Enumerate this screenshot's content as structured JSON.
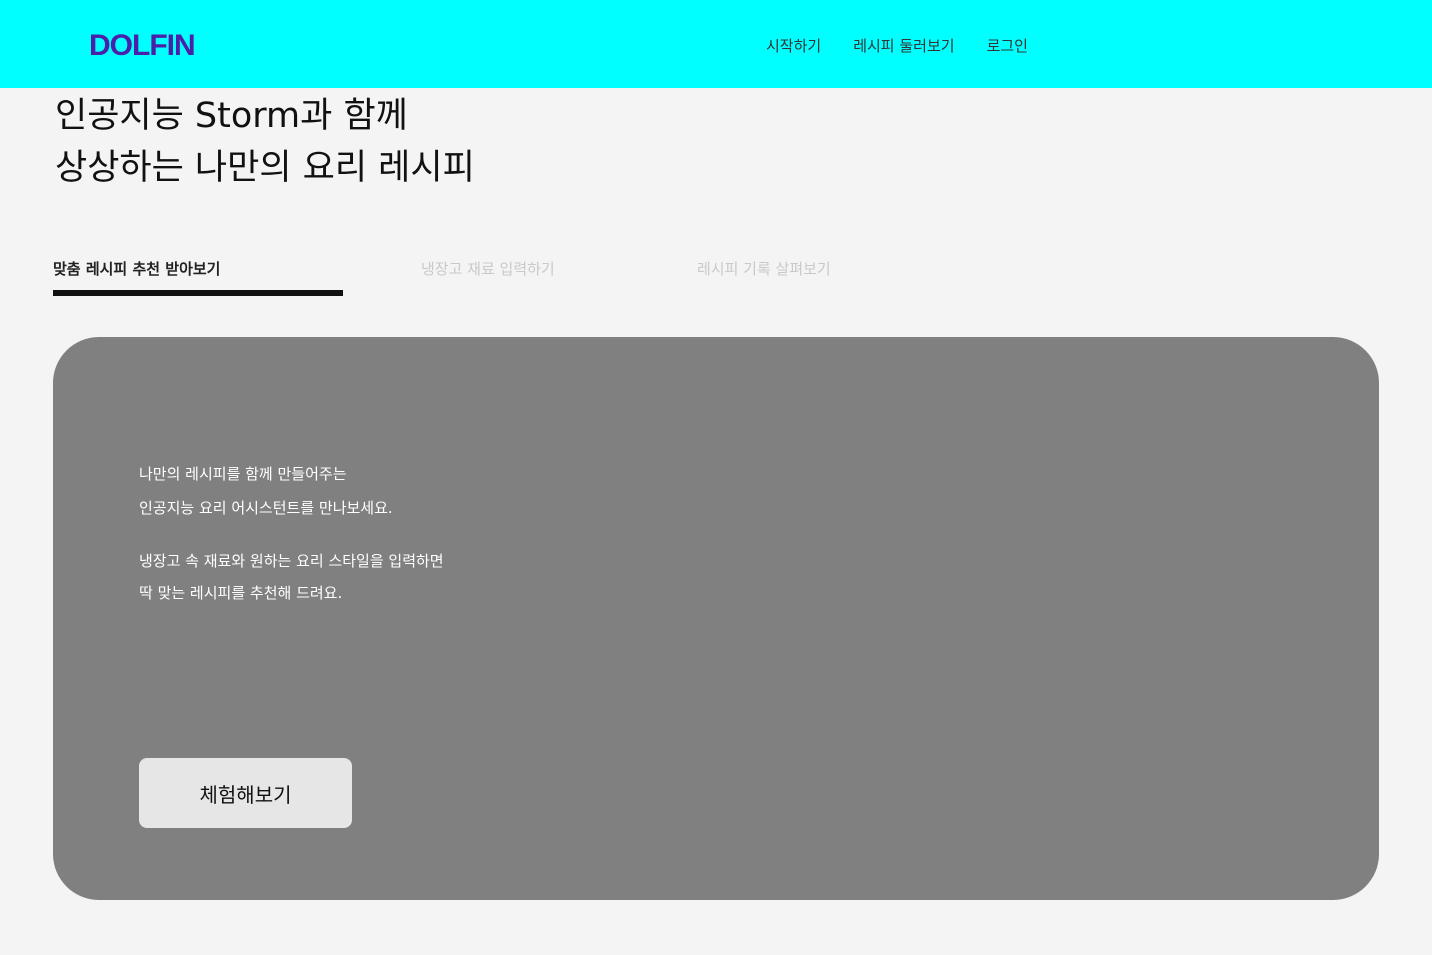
{
  "header": {
    "logo": "DOLFIN",
    "nav": [
      {
        "label": "시작하기"
      },
      {
        "label": "레시피 둘러보기"
      },
      {
        "label": "로그인"
      }
    ]
  },
  "hero": {
    "line1": "인공지능 Storm과 함께",
    "line2": "상상하는 나만의 요리 레시피"
  },
  "tabs": [
    {
      "label": "맞춤 레시피 추천 받아보기",
      "active": true
    },
    {
      "label": "냉장고 재료 입력하기",
      "active": false
    },
    {
      "label": "레시피 기록 살펴보기",
      "active": false
    }
  ],
  "card": {
    "line1": "나만의 레시피를 함께 만들어주는",
    "line2": "인공지능 요리 어시스턴트를 만나보세요.",
    "line3": "냉장고 속 재료와 원하는 요리 스타일을 입력하면",
    "line4": "딱 맞는 레시피를 추천해 드려요.",
    "button_label": "체험해보기"
  },
  "colors": {
    "header_bg": "#00ffff",
    "logo": "#4b1fa8",
    "card_bg": "#808080",
    "page_bg": "#f4f4f4"
  }
}
